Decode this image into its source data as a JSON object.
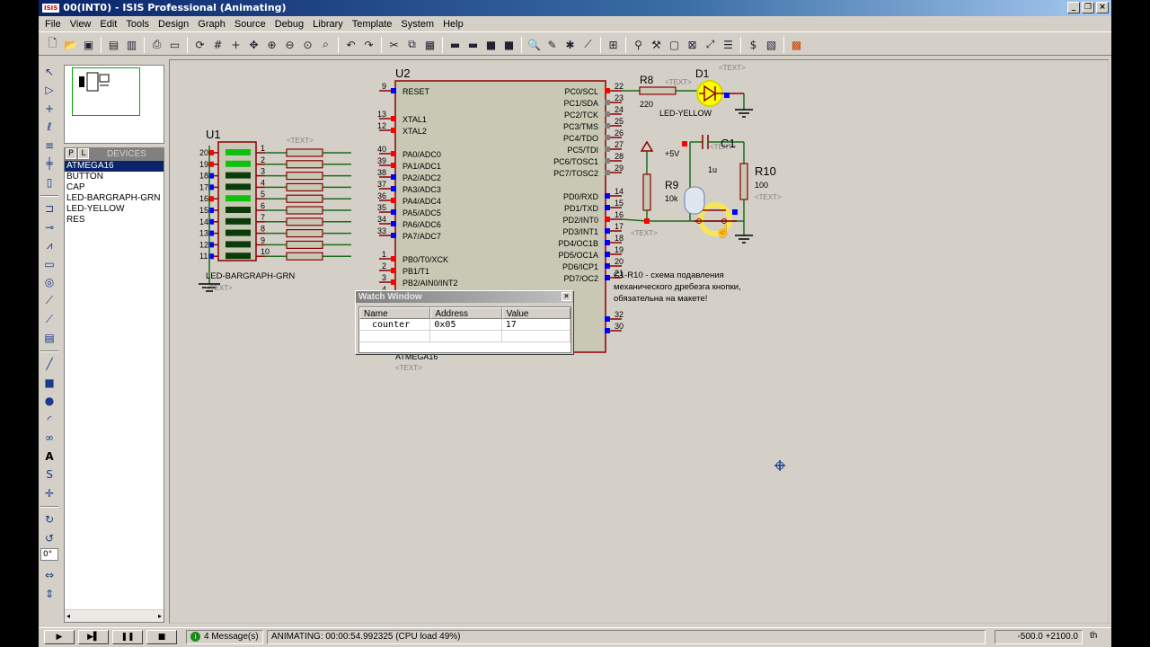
{
  "window": {
    "title": "00(INT0) - ISIS Professional (Animating)",
    "app_icon_label": "ISIS"
  },
  "menu": [
    "File",
    "View",
    "Edit",
    "Tools",
    "Design",
    "Graph",
    "Source",
    "Debug",
    "Library",
    "Template",
    "System",
    "Help"
  ],
  "devices": {
    "tab_p": "P",
    "tab_l": "L",
    "title": "DEVICES",
    "items": [
      "ATMEGA16",
      "BUTTON",
      "CAP",
      "LED-BARGRAPH-GRN",
      "LED-YELLOW",
      "RES"
    ],
    "selected": "ATMEGA16"
  },
  "tools": {
    "rotation_value": "0°"
  },
  "schematic": {
    "u1": {
      "ref": "U1",
      "part": "LED-BARGRAPH-GRN",
      "text": "<TEXT>",
      "left_pins": [
        "20",
        "19",
        "18",
        "17",
        "16",
        "15",
        "14",
        "13",
        "12",
        "11"
      ],
      "right_pins": [
        "1",
        "2",
        "3",
        "4",
        "5",
        "6",
        "7",
        "8",
        "9",
        "10"
      ],
      "lit": [
        true,
        true,
        false,
        false,
        true,
        false,
        false,
        false,
        false,
        false
      ]
    },
    "u2": {
      "ref": "U2",
      "part": "ATMEGA16",
      "text": "<TEXT>",
      "left_labels": [
        "RESET",
        "XTAL1",
        "XTAL2",
        "PA0/ADC0",
        "PA1/ADC1",
        "PA2/ADC2",
        "PA3/ADC3",
        "PA4/ADC4",
        "PA5/ADC5",
        "PA6/ADC6",
        "PA7/ADC7",
        "PB0/T0/XCK",
        "PB1/T1",
        "PB2/AIN0/INT2"
      ],
      "left_pins": [
        "9",
        "13",
        "12",
        "40",
        "39",
        "38",
        "37",
        "36",
        "35",
        "34",
        "33",
        "1",
        "2",
        "3",
        "4",
        "5",
        "6",
        "7",
        "8"
      ],
      "right_labels": [
        "PC0/SCL",
        "PC1/SDA",
        "PC2/TCK",
        "PC3/TMS",
        "PC4/TDO",
        "PC5/TDI",
        "PC6/TOSC1",
        "PC7/TOSC2",
        "PD0/RXD",
        "PD1/TXD",
        "PD2/INT0",
        "PD3/INT1",
        "PD4/OC1B",
        "PD5/OC1A",
        "PD6/ICP1",
        "PD7/OC2"
      ],
      "right_pins": [
        "22",
        "23",
        "24",
        "25",
        "26",
        "27",
        "28",
        "29",
        "14",
        "15",
        "16",
        "17",
        "18",
        "19",
        "20",
        "21",
        "32",
        "30"
      ]
    },
    "res_text": "<TEXT>",
    "r8": {
      "ref": "R8",
      "value": "220",
      "text": "<TEXT>"
    },
    "d1": {
      "ref": "D1",
      "part": "LED-YELLOW",
      "text": "<TEXT>"
    },
    "c1": {
      "ref": "C1",
      "value": "1u",
      "text": "<TEXT>"
    },
    "r9": {
      "ref": "R9",
      "value": "10k",
      "text": "<TEXT>"
    },
    "r10": {
      "ref": "R10",
      "value": "100",
      "text": "<TEXT>"
    },
    "vcc": "+5V",
    "note": "C1-R10 - схема подавления механического дребезга кнопки, обязательна на макете!"
  },
  "watch_window": {
    "title": "Watch Window",
    "close": "×",
    "columns": [
      "Name",
      "Address",
      "Value"
    ],
    "rows": [
      {
        "name": "counter",
        "address": "0x05",
        "value": "17"
      }
    ]
  },
  "status": {
    "messages": "4 Message(s)",
    "animating": "ANIMATING: 00:00:54.992325 (CPU load 49%)",
    "coords": "-500.0  +2100.0",
    "units": "th"
  },
  "colors": {
    "title_start": "#0a246a",
    "wire": "#1a6b1a",
    "component": "#8b0000",
    "chip_fill": "#c8c8b4",
    "pin_red": "#ff0000",
    "pin_blue": "#0000ff"
  }
}
